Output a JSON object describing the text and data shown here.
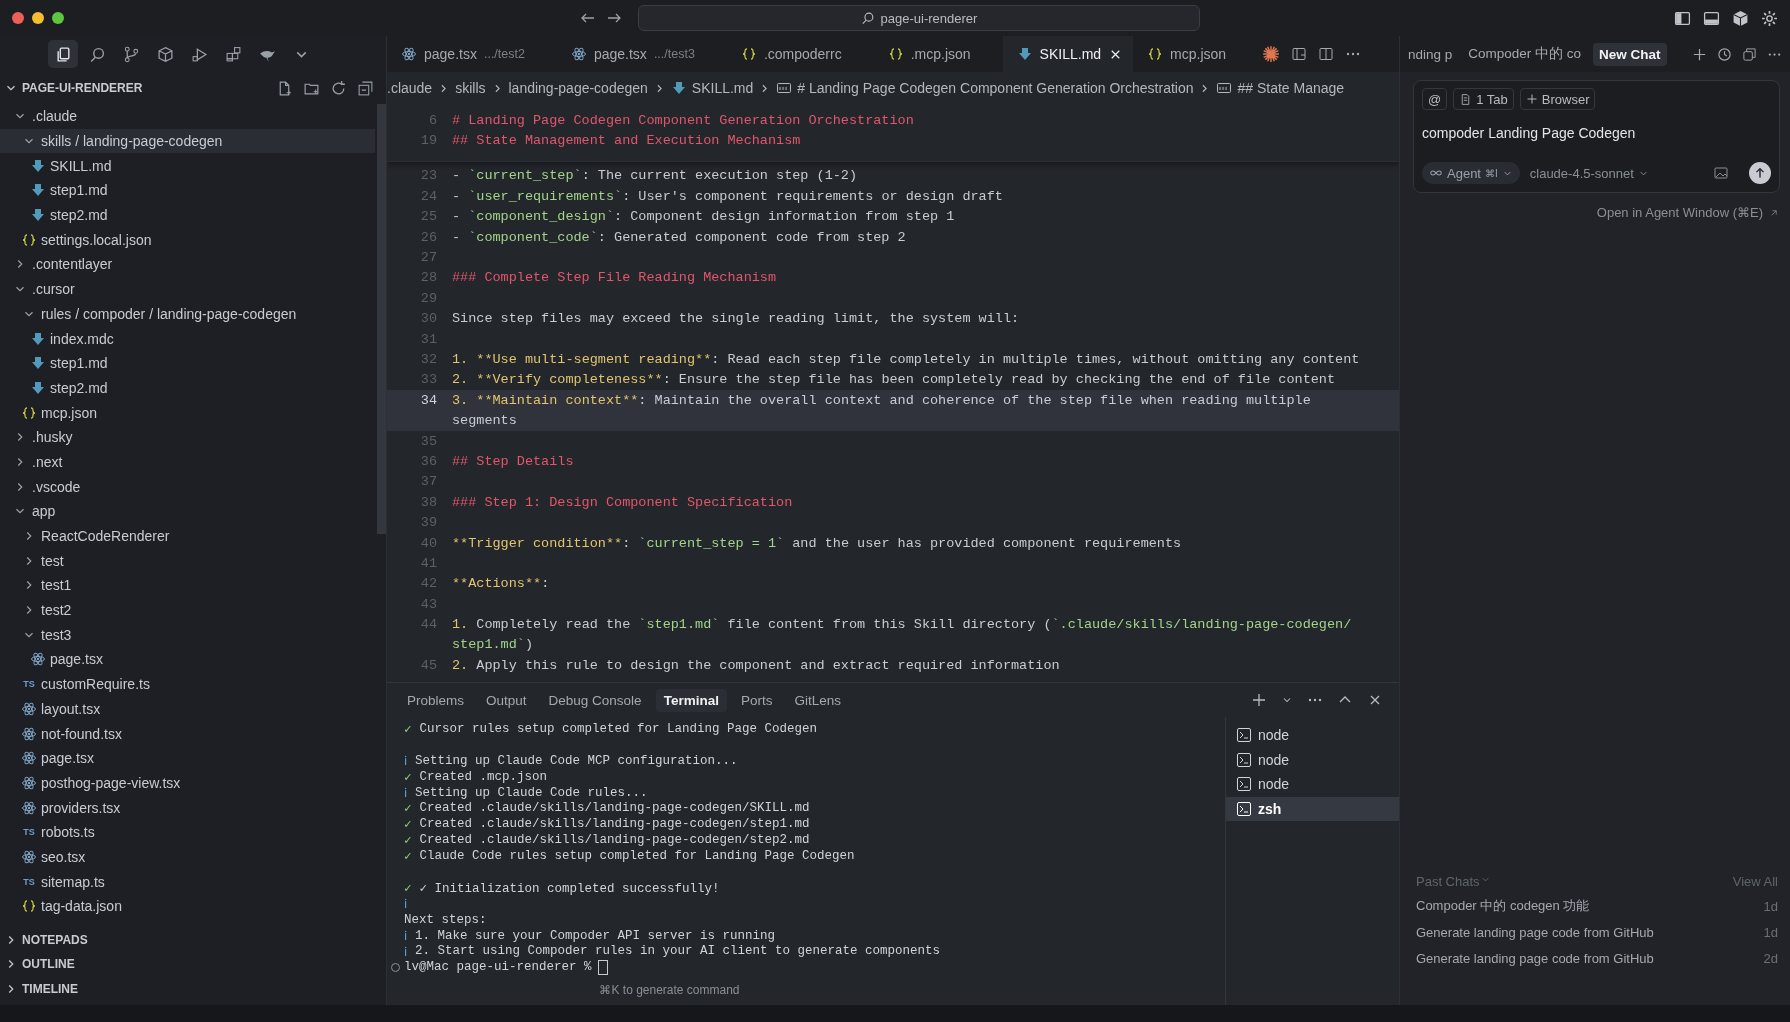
{
  "window": {
    "title": "page-ui-renderer"
  },
  "activity_bar": [
    {
      "kind": "files",
      "selected": true
    },
    {
      "kind": "search",
      "selected": false
    },
    {
      "kind": "branch",
      "selected": false
    },
    {
      "kind": "cube",
      "selected": false
    },
    {
      "kind": "run",
      "selected": false
    },
    {
      "kind": "blocks",
      "selected": false
    },
    {
      "kind": "bird",
      "selected": false
    },
    {
      "kind": "more",
      "selected": false
    }
  ],
  "explorer": {
    "title": "PAGE-UI-RENDERER",
    "tree": [
      {
        "label": ".claude",
        "kind": "folder",
        "expanded": true,
        "selected": false,
        "children": [
          {
            "label": "skills / landing-page-codegen",
            "kind": "folder",
            "expanded": true,
            "selected": true,
            "children": [
              {
                "label": "SKILL.md",
                "kind": "md",
                "selected": false
              },
              {
                "label": "step1.md",
                "kind": "md",
                "selected": false
              },
              {
                "label": "step2.md",
                "kind": "md",
                "selected": false
              }
            ]
          },
          {
            "label": "settings.local.json",
            "kind": "json",
            "selected": false
          }
        ]
      },
      {
        "label": ".contentlayer",
        "kind": "folder",
        "expanded": false,
        "selected": false
      },
      {
        "label": ".cursor",
        "kind": "folder",
        "expanded": true,
        "selected": false,
        "children": [
          {
            "label": "rules / compoder / landing-page-codegen",
            "kind": "folder",
            "expanded": true,
            "selected": false,
            "children": [
              {
                "label": "index.mdc",
                "kind": "md",
                "selected": false
              },
              {
                "label": "step1.md",
                "kind": "md",
                "selected": false
              },
              {
                "label": "step2.md",
                "kind": "md",
                "selected": false
              }
            ]
          },
          {
            "label": "mcp.json",
            "kind": "json",
            "selected": false
          }
        ]
      },
      {
        "label": ".husky",
        "kind": "folder",
        "expanded": false,
        "selected": false
      },
      {
        "label": ".next",
        "kind": "folder",
        "expanded": false,
        "selected": false
      },
      {
        "label": ".vscode",
        "kind": "folder",
        "expanded": false,
        "selected": false
      },
      {
        "label": "app",
        "kind": "folder",
        "expanded": true,
        "selected": false,
        "children": [
          {
            "label": "ReactCodeRenderer",
            "kind": "folder",
            "expanded": false,
            "selected": false
          },
          {
            "label": "test",
            "kind": "folder",
            "expanded": false,
            "selected": false
          },
          {
            "label": "test1",
            "kind": "folder",
            "expanded": false,
            "selected": false
          },
          {
            "label": "test2",
            "kind": "folder",
            "expanded": false,
            "selected": false
          },
          {
            "label": "test3",
            "kind": "folder",
            "expanded": true,
            "selected": false,
            "children": [
              {
                "label": "page.tsx",
                "kind": "react",
                "selected": false
              }
            ]
          },
          {
            "label": "customRequire.ts",
            "kind": "ts",
            "icon_text": "TS",
            "selected": false
          },
          {
            "label": "layout.tsx",
            "kind": "react",
            "selected": false
          },
          {
            "label": "not-found.tsx",
            "kind": "react",
            "selected": false
          },
          {
            "label": "page.tsx",
            "kind": "react",
            "selected": false
          },
          {
            "label": "posthog-page-view.tsx",
            "kind": "react",
            "selected": false
          },
          {
            "label": "providers.tsx",
            "kind": "react",
            "selected": false
          },
          {
            "label": "robots.ts",
            "kind": "ts",
            "icon_text": "TS",
            "selected": false
          },
          {
            "label": "seo.tsx",
            "kind": "react",
            "selected": false
          },
          {
            "label": "sitemap.ts",
            "kind": "ts",
            "icon_text": "TS",
            "selected": false
          },
          {
            "label": "tag-data.json",
            "kind": "json",
            "selected": false
          }
        ]
      }
    ]
  },
  "sections": [
    {
      "label": "NOTEPADS",
      "expanded": false
    },
    {
      "label": "OUTLINE",
      "expanded": false
    },
    {
      "label": "TIMELINE",
      "expanded": false
    }
  ],
  "tabs": [
    {
      "label": "page.tsx",
      "detail": ".../test2",
      "kind": "react",
      "selected": false
    },
    {
      "label": "page.tsx",
      "detail": ".../test3",
      "kind": "react",
      "selected": false
    },
    {
      "label": ".compoderrc",
      "kind": "json",
      "selected": false
    },
    {
      "label": ".mcp.json",
      "kind": "json",
      "selected": false
    },
    {
      "label": "SKILL.md",
      "kind": "md",
      "selected": true
    },
    {
      "label": "mcp.json",
      "kind": "json",
      "selected": false
    }
  ],
  "breadcrumb": [
    {
      "label": ".claude",
      "kind": "folder"
    },
    {
      "label": "skills",
      "kind": "folder"
    },
    {
      "label": "landing-page-codegen",
      "kind": "folder"
    },
    {
      "label": "SKILL.md",
      "kind": "md"
    },
    {
      "label": "# Landing Page Codegen Component Generation Orchestration",
      "kind": "symbol"
    },
    {
      "label": "## State Manage",
      "kind": "symbol"
    }
  ],
  "sticky_lines": [
    {
      "number": "6",
      "segments": [
        {
          "kind": "heading",
          "text": "# Landing Page Codegen Component Generation Orchestration"
        }
      ]
    },
    {
      "number": "19",
      "segments": [
        {
          "kind": "heading",
          "text": "## State Management and Execution Mechanism"
        }
      ]
    }
  ],
  "lines": [
    {
      "number": "23",
      "current": false,
      "segments": [
        {
          "kind": "text",
          "text": "- "
        },
        {
          "kind": "code",
          "text": "`current_step`"
        },
        {
          "kind": "text",
          "text": ": The current execution step (1-2)"
        }
      ]
    },
    {
      "number": "24",
      "current": false,
      "segments": [
        {
          "kind": "text",
          "text": "- "
        },
        {
          "kind": "code",
          "text": "`user_requirements`"
        },
        {
          "kind": "text",
          "text": ": User's component requirements or design draft"
        }
      ]
    },
    {
      "number": "25",
      "current": false,
      "segments": [
        {
          "kind": "text",
          "text": "- "
        },
        {
          "kind": "code",
          "text": "`component_design`"
        },
        {
          "kind": "text",
          "text": ": Component design information from step 1"
        }
      ]
    },
    {
      "number": "26",
      "current": false,
      "segments": [
        {
          "kind": "text",
          "text": "- "
        },
        {
          "kind": "code",
          "text": "`component_code`"
        },
        {
          "kind": "text",
          "text": ": Generated component code from step 2"
        }
      ]
    },
    {
      "number": "27",
      "current": false
    },
    {
      "number": "28",
      "current": false,
      "segments": [
        {
          "kind": "heading",
          "text": "### Complete Step File Reading Mechanism"
        }
      ]
    },
    {
      "number": "29",
      "current": false
    },
    {
      "number": "30",
      "current": false,
      "segments": [
        {
          "kind": "text",
          "text": "Since step files may exceed the single reading limit, the system will:"
        }
      ]
    },
    {
      "number": "31",
      "current": false
    },
    {
      "number": "32",
      "current": false,
      "segments": [
        {
          "kind": "marker",
          "text": "1. "
        },
        {
          "kind": "bold",
          "text": "**Use multi-segment reading**"
        },
        {
          "kind": "text",
          "text": ": Read each step file completely in multiple times, without omitting any content"
        }
      ]
    },
    {
      "number": "33",
      "current": false,
      "segments": [
        {
          "kind": "marker",
          "text": "2. "
        },
        {
          "kind": "bold",
          "text": "**Verify completeness**"
        },
        {
          "kind": "text",
          "text": ": Ensure the step file has been completely read by checking the end of file content"
        }
      ]
    },
    {
      "number": "34",
      "current": true,
      "segments": [
        {
          "kind": "marker",
          "text": "3. "
        },
        {
          "kind": "bold",
          "text": "**Maintain context**"
        },
        {
          "kind": "text",
          "text": ": Maintain the overall context and coherence of the step file when reading multiple"
        }
      ]
    },
    {
      "current": true,
      "segments": [
        {
          "kind": "text",
          "text": "segments"
        }
      ]
    },
    {
      "number": "35",
      "current": false
    },
    {
      "number": "36",
      "current": false,
      "segments": [
        {
          "kind": "heading",
          "text": "## Step Details"
        }
      ]
    },
    {
      "number": "37",
      "current": false
    },
    {
      "number": "38",
      "current": false,
      "segments": [
        {
          "kind": "heading",
          "text": "### Step 1: Design Component Specification"
        }
      ]
    },
    {
      "number": "39",
      "current": false
    },
    {
      "number": "40",
      "current": false,
      "segments": [
        {
          "kind": "bold",
          "text": "**Trigger condition**"
        },
        {
          "kind": "text",
          "text": ": "
        },
        {
          "kind": "code",
          "text": "`current_step = 1`"
        },
        {
          "kind": "text",
          "text": " and the user has provided component requirements"
        }
      ]
    },
    {
      "number": "41",
      "current": false
    },
    {
      "number": "42",
      "current": false,
      "segments": [
        {
          "kind": "bold",
          "text": "**Actions**"
        },
        {
          "kind": "text",
          "text": ":"
        }
      ]
    },
    {
      "number": "43",
      "current": false
    },
    {
      "number": "44",
      "current": false,
      "segments": [
        {
          "kind": "marker",
          "text": "1. "
        },
        {
          "kind": "text",
          "text": "Completely read the "
        },
        {
          "kind": "code",
          "text": "`step1.md`"
        },
        {
          "kind": "text",
          "text": " file content from this Skill directory ("
        },
        {
          "kind": "code",
          "text": "`.claude/skills/landing-page-codegen/"
        }
      ]
    },
    {
      "current": false,
      "segments": [
        {
          "kind": "code",
          "text": "step1.md`"
        },
        {
          "kind": "text",
          "text": ")"
        }
      ]
    },
    {
      "number": "45",
      "current": false,
      "segments": [
        {
          "kind": "marker",
          "text": "2. "
        },
        {
          "kind": "text",
          "text": "Apply this rule to design the component and extract required information"
        }
      ]
    }
  ],
  "panel": {
    "tabs": [
      {
        "label": "Problems",
        "selected": false
      },
      {
        "label": "Output",
        "selected": false
      },
      {
        "label": "Debug Console",
        "selected": false
      },
      {
        "label": "Terminal",
        "selected": true
      },
      {
        "label": "Ports",
        "selected": false
      },
      {
        "label": "GitLens",
        "selected": false
      }
    ],
    "terminal": [
      {
        "kind": "success",
        "mark": "✓",
        "text": "Cursor rules setup completed for Landing Page Codegen"
      },
      {
        "kind": "blank"
      },
      {
        "kind": "info",
        "mark": "ℹ",
        "text": "Setting up Claude Code MCP configuration..."
      },
      {
        "kind": "success",
        "mark": "✓",
        "text": "Created .mcp.json"
      },
      {
        "kind": "info",
        "mark": "ℹ",
        "text": "Setting up Claude Code rules..."
      },
      {
        "kind": "success",
        "mark": "✓",
        "text": "Created .claude/skills/landing-page-codegen/SKILL.md"
      },
      {
        "kind": "success",
        "mark": "✓",
        "text": "Created .claude/skills/landing-page-codegen/step1.md"
      },
      {
        "kind": "success",
        "mark": "✓",
        "text": "Created .claude/skills/landing-page-codegen/step2.md"
      },
      {
        "kind": "success",
        "mark": "✓",
        "text": "Claude Code rules setup completed for Landing Page Codegen"
      },
      {
        "kind": "blank"
      },
      {
        "kind": "success",
        "mark": "✓",
        "text": "✓ Initialization completed successfully!"
      },
      {
        "kind": "info",
        "mark": "ℹ"
      },
      {
        "kind": "plain",
        "text": "Next steps:"
      },
      {
        "kind": "info",
        "mark": "ℹ",
        "text": "1. Make sure your Compoder API server is running"
      },
      {
        "kind": "info",
        "mark": "ℹ",
        "text": "2. Start using Compoder rules in your AI client to generate components"
      },
      {
        "kind": "prompt",
        "text": "lv@Mac page-ui-renderer %"
      }
    ],
    "hint": "⌘K to generate command",
    "sessions": [
      {
        "label": "node",
        "selected": false
      },
      {
        "label": "node",
        "selected": false
      },
      {
        "label": "node",
        "selected": false
      },
      {
        "label": "zsh",
        "selected": true
      }
    ]
  },
  "chat": {
    "tabs": [
      {
        "label": "nding p",
        "selected": false
      },
      {
        "label": "Compoder 中的 co",
        "selected": false
      },
      {
        "label": "New Chat",
        "selected": true
      }
    ],
    "chips": [
      {
        "kind": "mention",
        "label": "@"
      },
      {
        "kind": "tab",
        "label": "1 Tab"
      },
      {
        "kind": "add",
        "label": "Browser"
      }
    ],
    "input": {
      "value": "compoder Landing Page Codegen"
    },
    "mode": {
      "label": "Agent",
      "shortcut": "⌘I"
    },
    "model": "claude-4.5-sonnet",
    "open_window": "Open in Agent Window (⌘E)",
    "past_chats": {
      "title": "Past Chats",
      "view_all": "View All",
      "items": [
        {
          "title": "Compoder 中的 codegen 功能",
          "age": "1d"
        },
        {
          "title": "Generate landing page code from GitHub",
          "age": "1d"
        },
        {
          "title": "Generate landing page code from GitHub",
          "age": "2d"
        }
      ]
    }
  }
}
